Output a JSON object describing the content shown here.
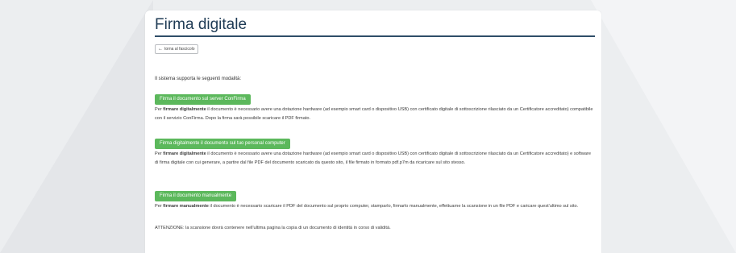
{
  "page": {
    "title": "Firma digitale",
    "back_label": "torna al fascicolo",
    "intro": "Il sistema supporta le seguenti modalità:"
  },
  "options": [
    {
      "button": "Firma il documento sul server ConFirma",
      "lead": "Per ",
      "bold": "firmare digitalmente",
      "text": " il documento è necessario avere una dotazione hardware (ad esempio smart card o dispositivo USB) con certificato digitale di sottoscrizione rilasciato da un Certificatore accreditato) compatibile con il servizio ConFirma. Dopo la firma sarà possibile scaricare il PDF firmato."
    },
    {
      "button": "Firma digitalmente il documento sul tuo personal computer",
      "lead": "Per ",
      "bold": "firmare digitalmente",
      "text": " il documento è necessario avere una dotazione hardware (ad esempio smart card o dispositivo USB) con certificato digitale di sottoscrizione rilasciato da un Certificatore accreditato) e software di firma digitale con cui generare, a partire dal file PDF del documento scaricato da questo sito, il file firmato in formato pdf.p7m da ricaricare sul sito stesso."
    },
    {
      "button": "Firma il documento manualmente",
      "lead": "Per ",
      "bold": "firmare manualmente",
      "text": " il documento è necessario scaricare il PDF del documento sul proprio computer, stamparlo, firmarlo manualmente, effettuarne la scansione in un file PDF e caricare quest'ultimo sul sito.",
      "note": "ATTENZIONE: la scansione dovrà contenere nell'ultima pagina la copia di un documento di identità in corso di validità."
    }
  ],
  "colors": {
    "button_green": "#5cb85c",
    "title": "#1f3b55",
    "rule": "#2f4d68"
  },
  "icons": {
    "back": "arrow-left-icon"
  }
}
